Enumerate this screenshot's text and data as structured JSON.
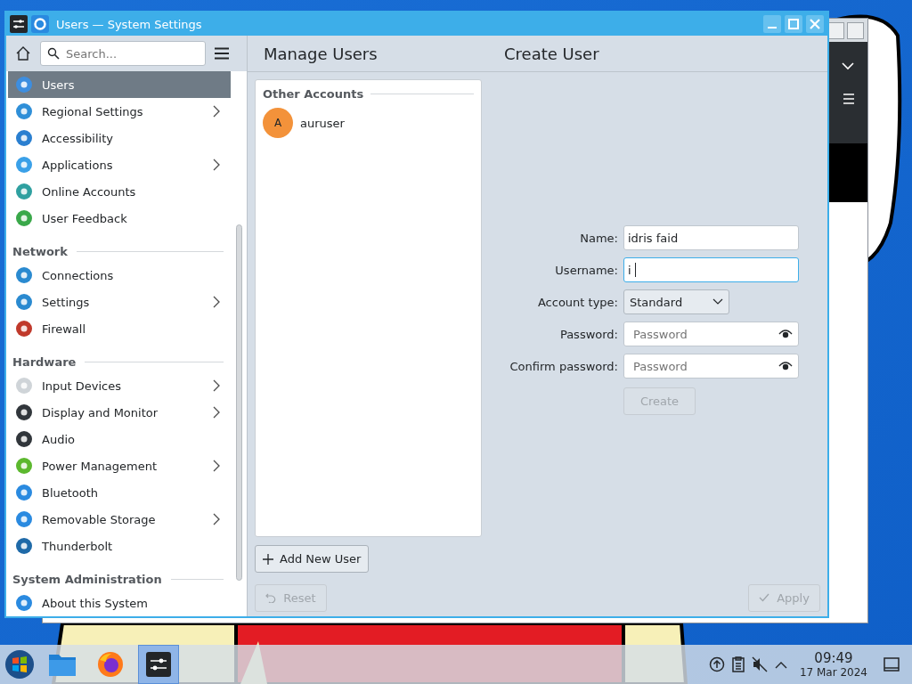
{
  "window": {
    "title": "Users — System Settings"
  },
  "sidebar": {
    "search": {
      "placeholder": "Search..."
    },
    "items": [
      {
        "kind": "item",
        "label": "Users",
        "selected": true,
        "submenu": false
      },
      {
        "kind": "item",
        "label": "Regional Settings",
        "selected": false,
        "submenu": true
      },
      {
        "kind": "item",
        "label": "Accessibility",
        "selected": false,
        "submenu": false
      },
      {
        "kind": "item",
        "label": "Applications",
        "selected": false,
        "submenu": true
      },
      {
        "kind": "item",
        "label": "Online Accounts",
        "selected": false,
        "submenu": false
      },
      {
        "kind": "item",
        "label": "User Feedback",
        "selected": false,
        "submenu": false
      },
      {
        "kind": "heading",
        "label": "Network"
      },
      {
        "kind": "item",
        "label": "Connections",
        "selected": false,
        "submenu": false
      },
      {
        "kind": "item",
        "label": "Settings",
        "selected": false,
        "submenu": true
      },
      {
        "kind": "item",
        "label": "Firewall",
        "selected": false,
        "submenu": false
      },
      {
        "kind": "heading",
        "label": "Hardware"
      },
      {
        "kind": "item",
        "label": "Input Devices",
        "selected": false,
        "submenu": true
      },
      {
        "kind": "item",
        "label": "Display and Monitor",
        "selected": false,
        "submenu": true
      },
      {
        "kind": "item",
        "label": "Audio",
        "selected": false,
        "submenu": false
      },
      {
        "kind": "item",
        "label": "Power Management",
        "selected": false,
        "submenu": true
      },
      {
        "kind": "item",
        "label": "Bluetooth",
        "selected": false,
        "submenu": false
      },
      {
        "kind": "item",
        "label": "Removable Storage",
        "selected": false,
        "submenu": true
      },
      {
        "kind": "item",
        "label": "Thunderbolt",
        "selected": false,
        "submenu": false
      },
      {
        "kind": "heading",
        "label": "System Administration"
      },
      {
        "kind": "item",
        "label": "About this System",
        "selected": false,
        "submenu": false
      }
    ]
  },
  "header": {
    "left": "Manage Users",
    "right": "Create User"
  },
  "accounts": {
    "heading": "Other Accounts",
    "users": [
      {
        "avatar": "A",
        "name": "auruser"
      }
    ]
  },
  "add_button": "Add New User",
  "form": {
    "fields": [
      {
        "kind": "text",
        "label": "Name:",
        "value": "idris faid",
        "focused": false
      },
      {
        "kind": "text",
        "label": "Username:",
        "value": "i",
        "focused": true
      },
      {
        "kind": "select",
        "label": "Account type:",
        "value": "Standard"
      },
      {
        "kind": "password",
        "label": "Password:",
        "placeholder": "Password"
      },
      {
        "kind": "password",
        "label": "Confirm password:",
        "placeholder": "Password"
      }
    ],
    "create": {
      "label": "Create",
      "disabled": true
    }
  },
  "footer": {
    "reset": {
      "label": "Reset",
      "disabled": true
    },
    "apply": {
      "label": "Apply",
      "disabled": true
    }
  },
  "taskbar": {
    "apps": [
      {
        "kind": "files",
        "active": false
      },
      {
        "kind": "firefox",
        "active": false
      },
      {
        "kind": "settings",
        "active": true
      }
    ],
    "clock": {
      "time": "09:49",
      "date": "17 Mar 2024"
    }
  }
}
